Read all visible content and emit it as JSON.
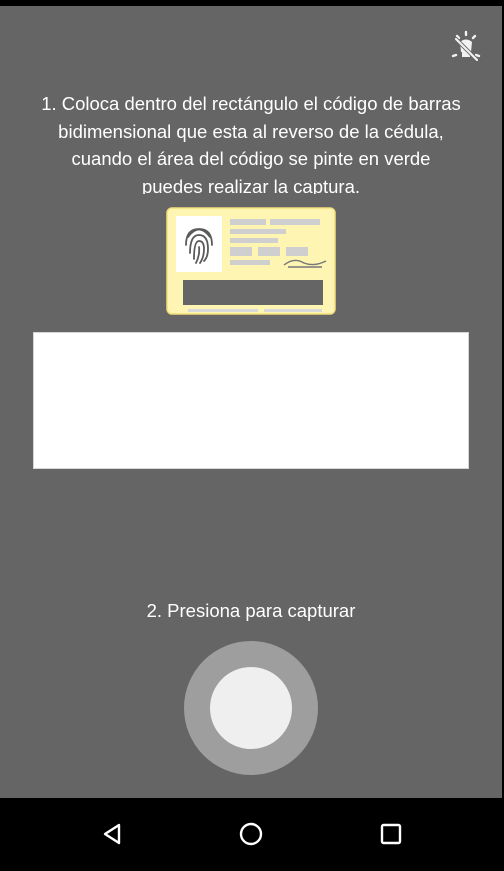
{
  "instructions": {
    "line1": "1. Coloca dentro del rectángulo el código de barras",
    "line2": "bidimensional que esta al reverso de la cédula,",
    "line3": "cuando el área del código se pinte en verde",
    "line4": "puedes realizar la captura."
  },
  "capture": {
    "label": "2. Presiona para capturar"
  },
  "icons": {
    "flash": "flash-off-icon",
    "card": "id-card-back-icon",
    "fingerprint": "fingerprint-icon",
    "back": "back-triangle-icon",
    "home": "home-circle-icon",
    "recent": "recent-square-icon"
  },
  "colors": {
    "background": "#656565",
    "card": "#fff5b3",
    "capture_ring": "#9e9e9e",
    "capture_button": "#efefef"
  }
}
